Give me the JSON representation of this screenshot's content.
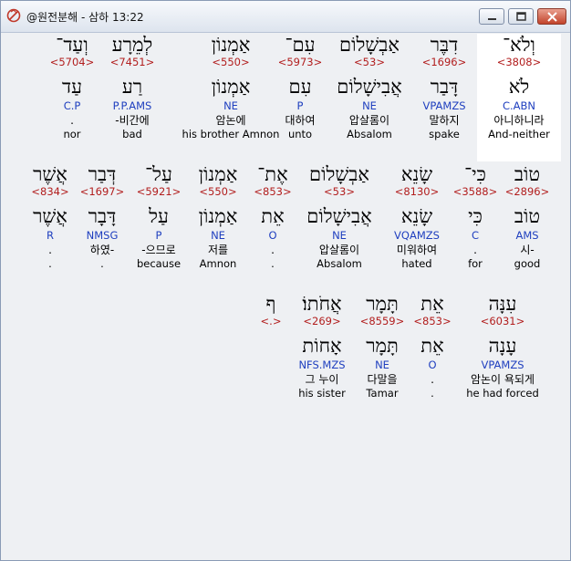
{
  "window": {
    "title": "@원전분해 - 삼하 13:22"
  },
  "rows": [
    {
      "words": [
        {
          "heb": "וְלֹא־",
          "strong": "<3808>",
          "lemma": "לֹא",
          "morph": "C.ABN",
          "kor": "아니하니라",
          "eng": "And-neither",
          "selected": true
        },
        {
          "heb": "דִבֶּר",
          "strong": "<1696>",
          "lemma": "דָּבַר",
          "morph": "VPAMZS",
          "kor": "말하지",
          "eng": "spake",
          "selected": false
        },
        {
          "heb": "אַבְשָׁלוֹם",
          "strong": "<53>",
          "lemma": "אֲבִישָׁלוֹם",
          "morph": "NE",
          "kor": "압살롬이",
          "eng": "Absalom",
          "selected": false
        },
        {
          "heb": "עִם־",
          "strong": "<5973>",
          "lemma": "עִם",
          "morph": "P",
          "kor": "대하여",
          "eng": "unto",
          "selected": false
        },
        {
          "heb": "אַמְנוֹן",
          "strong": "<550>",
          "lemma": "אַמְנוֹן",
          "morph": "NE",
          "kor": "암논에",
          "eng": "his brother Amnon",
          "selected": false
        },
        {
          "heb": "לְמֵרָע",
          "strong": "<7451>",
          "lemma": "רַע",
          "morph": "P.P.AMS",
          "kor": "-비간에",
          "eng": "bad",
          "selected": false
        },
        {
          "heb": "וְעַד־",
          "strong": "<5704>",
          "lemma": "עַד",
          "morph": "C.P",
          "kor": ".",
          "eng": "nor",
          "selected": false
        }
      ]
    },
    {
      "words": [
        {
          "heb": "טוֹב",
          "strong": "<2896>",
          "lemma": "טוֹב",
          "morph": "AMS",
          "kor": "시-",
          "eng": "good",
          "selected": false
        },
        {
          "heb": "כִּי־",
          "strong": "<3588>",
          "lemma": "כִּי",
          "morph": "C",
          "kor": ".",
          "eng": "for",
          "selected": false
        },
        {
          "heb": "שָׂנֵא",
          "strong": "<8130>",
          "lemma": "שָׂנֵא",
          "morph": "VQAMZS",
          "kor": "미워하여",
          "eng": "hated",
          "selected": false
        },
        {
          "heb": "אַבְשָׁלוֹם",
          "strong": "<53>",
          "lemma": "אֲבִישָׁלוֹם",
          "morph": "NE",
          "kor": "압살롬이",
          "eng": "Absalom",
          "selected": false
        },
        {
          "heb": "אֶת־",
          "strong": "<853>",
          "lemma": "אֵת",
          "morph": "O",
          "kor": ".",
          "eng": ".",
          "selected": false
        },
        {
          "heb": "אַמְנוֹן",
          "strong": "<550>",
          "lemma": "אַמְנוֹן",
          "morph": "NE",
          "kor": "저를",
          "eng": "Amnon",
          "selected": false
        },
        {
          "heb": "עַל־",
          "strong": "<5921>",
          "lemma": "עַל",
          "morph": "P",
          "kor": "-으므로",
          "eng": "because",
          "selected": false
        },
        {
          "heb": "דְּבַר",
          "strong": "<1697>",
          "lemma": "דָּבָר",
          "morph": "NMSG",
          "kor": "하였-",
          "eng": ".",
          "selected": false
        },
        {
          "heb": "אֲשֶׁר",
          "strong": "<834>",
          "lemma": "אֲשֶׁר",
          "morph": "R",
          "kor": ".",
          "eng": ".",
          "selected": false
        }
      ]
    },
    {
      "words": [
        {
          "heb": "עִנָּה",
          "strong": "<6031>",
          "lemma": "עָנָה",
          "morph": "VPAMZS",
          "kor": "암논이 욕되게",
          "eng": "he had forced",
          "selected": false
        },
        {
          "heb": "אֵת",
          "strong": "<853>",
          "lemma": "אֵת",
          "morph": "O",
          "kor": ".",
          "eng": ".",
          "selected": false
        },
        {
          "heb": "תָּמָר",
          "strong": "<8559>",
          "lemma": "תָּמָר",
          "morph": "NE",
          "kor": "다말을",
          "eng": "Tamar",
          "selected": false
        },
        {
          "heb": "אֲחֹתוֹ׃",
          "strong": "<269>",
          "lemma": "אָחוֹת",
          "morph": "NFS.MZS",
          "kor": "그 누이",
          "eng": "his sister",
          "selected": false
        },
        {
          "heb": "ף",
          "strong": "<.>",
          "lemma": "",
          "morph": "",
          "kor": "",
          "eng": "",
          "selected": false
        }
      ]
    }
  ]
}
